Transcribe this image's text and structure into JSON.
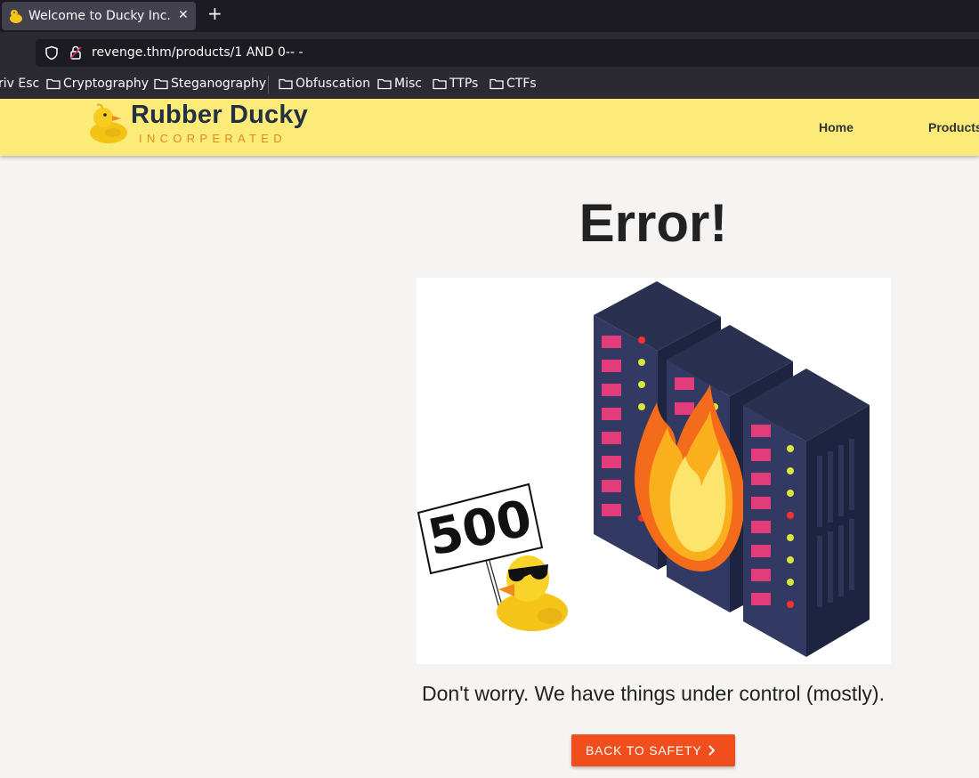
{
  "browser": {
    "tab_title": "Welcome to Ducky Inc.",
    "close_glyph": "✕",
    "new_tab_glyph": "+",
    "url": "revenge.thm/products/1 AND 0-- -"
  },
  "bookmarks": [
    {
      "label": "riv Esc",
      "folder": false
    },
    {
      "label": "Cryptography",
      "folder": true
    },
    {
      "label": "Steganography",
      "folder": true
    },
    {
      "label": "Obfuscation",
      "folder": true
    },
    {
      "label": "Misc",
      "folder": true
    },
    {
      "label": "TTPs",
      "folder": true
    },
    {
      "label": "CTFs",
      "folder": true
    }
  ],
  "site": {
    "logo_title": "Rubber Ducky",
    "logo_subtitle": "INCORPERATED",
    "nav": [
      "Home",
      "Products"
    ],
    "header_color": "#fdeb79"
  },
  "main": {
    "heading": "Error!",
    "sign_text": "500",
    "message": "Don't worry. We have things under control (mostly).",
    "button_label": "BACK TO SAFETY",
    "button_color": "#f04e1c"
  },
  "icons": [
    "duck-favicon-icon",
    "shield-icon",
    "lock-icon",
    "folder-icon",
    "duck-logo-icon",
    "chevron-right-icon"
  ]
}
